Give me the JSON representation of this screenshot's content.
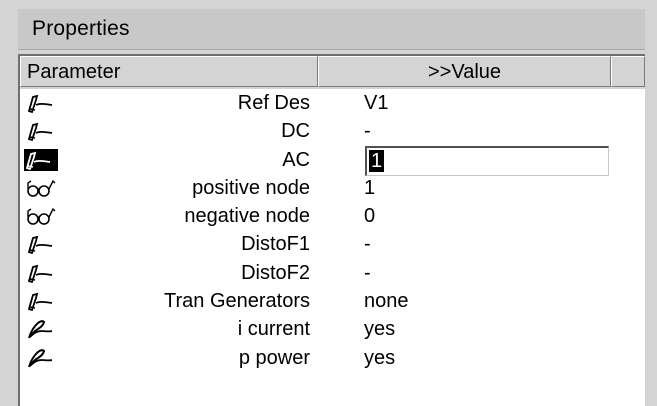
{
  "panel": {
    "title": "Properties"
  },
  "table": {
    "headers": {
      "parameter": "Parameter",
      "value": ">>Value"
    },
    "rows": [
      {
        "icon": "pencil-icon",
        "name": "Ref Des",
        "value": "V1"
      },
      {
        "icon": "pencil-icon",
        "name": "DC",
        "value": "-"
      },
      {
        "icon": "pencil-icon",
        "name": "AC",
        "value": "1",
        "editing": true
      },
      {
        "icon": "glasses-icon",
        "name": "positive node",
        "value": "1"
      },
      {
        "icon": "glasses-icon",
        "name": "negative node",
        "value": "0"
      },
      {
        "icon": "pencil-icon",
        "name": "DistoF1",
        "value": "-"
      },
      {
        "icon": "pencil-icon",
        "name": "DistoF2",
        "value": "-"
      },
      {
        "icon": "pencil-icon",
        "name": "Tran Generators",
        "value": "none"
      },
      {
        "icon": "quill-icon",
        "name": "i current",
        "value": "yes"
      },
      {
        "icon": "quill-icon",
        "name": "p power",
        "value": "yes"
      }
    ]
  },
  "colors": {
    "panel_bg": "#d4d4d4",
    "table_bg": "#ffffff",
    "selection_bg": "#000000"
  }
}
